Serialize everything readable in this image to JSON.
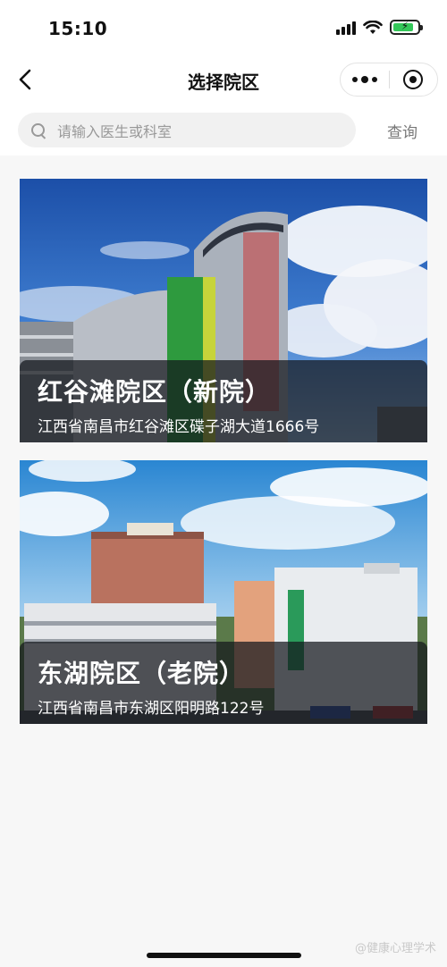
{
  "status_bar": {
    "time": "15:10",
    "battery_level": 0.85,
    "icons": [
      "signal-icon",
      "wifi-icon",
      "battery-charging-icon"
    ]
  },
  "nav": {
    "title": "选择院区",
    "back_icon": "back-chevron-icon",
    "more_icon": "more-dots-icon",
    "close_icon": "target-close-icon"
  },
  "search": {
    "placeholder": "请输入医生或科室",
    "query_label": "查询"
  },
  "campuses": [
    {
      "name": "红谷滩院区（新院）",
      "address": "江西省南昌市红谷滩区碟子湖大道1666号"
    },
    {
      "name": "东湖院区（老院）",
      "address": "江西省南昌市东湖区阳明路122号"
    }
  ],
  "watermark": "@健康心理学术",
  "colors": {
    "battery_green": "#34c759",
    "overlay": "#14161c"
  }
}
